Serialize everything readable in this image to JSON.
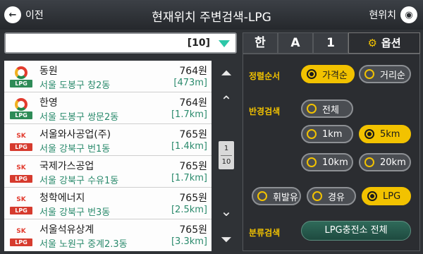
{
  "header": {
    "back_label": "이전",
    "title": "현재위치 주변검색-LPG",
    "current_position_label": "현위치",
    "back_icon": "←",
    "current_position_icon": "◉"
  },
  "search": {
    "count": "[10]"
  },
  "list": [
    {
      "brand": "green",
      "name": "동원",
      "price": "764원",
      "address": "서울 도봉구 창2동",
      "distance": "[473m]"
    },
    {
      "brand": "green",
      "name": "한영",
      "price": "764원",
      "address": "서울 도봉구 쌍문2동",
      "distance": "[1.7km]"
    },
    {
      "brand": "red",
      "name": "서울와사공업(주)",
      "price": "765원",
      "address": "서울 강북구 번1동",
      "distance": "[1.4km]"
    },
    {
      "brand": "red",
      "name": "국제가스공업",
      "price": "765원",
      "address": "서울 강북구 수유1동",
      "distance": "[1.7km]"
    },
    {
      "brand": "red",
      "name": "청학에너지",
      "price": "765원",
      "address": "서울 강북구 번3동",
      "distance": "[2.5km]"
    },
    {
      "brand": "red",
      "name": "서울석유상계",
      "price": "765원",
      "address": "서울 노원구 중계2.3동",
      "distance": "[3.3km]"
    }
  ],
  "logo": {
    "lpg_text": "LPG",
    "sk_text": "SK"
  },
  "pager": {
    "current": "1",
    "total": "10"
  },
  "tabs": {
    "korean": "한",
    "alpha": "A",
    "number": "1",
    "options": "옵션"
  },
  "options": {
    "sort_label": "정렬순서",
    "sort_price": "가격순",
    "sort_distance": "거리순",
    "radius_label": "반경검색",
    "radius_all": "전체",
    "radius_1": "1km",
    "radius_5": "5km",
    "radius_10": "10km",
    "radius_20": "20km",
    "fuel_gasoline": "휘발유",
    "fuel_diesel": "경유",
    "fuel_lpg": "LPG",
    "category_label": "분류검색",
    "category_button": "LPG충전소 전체"
  },
  "colors": {
    "accent": "#f2c200",
    "text_green": "#2a8a6c",
    "dropdown": "#2cc7a8"
  }
}
